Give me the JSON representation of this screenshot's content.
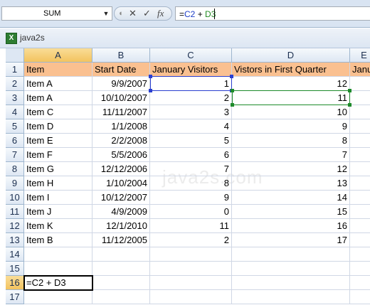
{
  "name_box": {
    "value": "SUM"
  },
  "formula_buttons": {
    "cancel": "✕",
    "enter": "✓",
    "fx": "fx"
  },
  "formula": {
    "prefix": "=",
    "ref1": "C2",
    "op": " + ",
    "ref2": "D3"
  },
  "workbook": {
    "title": "java2s"
  },
  "watermark": "java2s.com",
  "columns": [
    "A",
    "B",
    "C",
    "D",
    "E"
  ],
  "active_column": "A",
  "row_numbers": [
    "1",
    "2",
    "3",
    "4",
    "5",
    "6",
    "7",
    "8",
    "9",
    "10",
    "11",
    "12",
    "13",
    "14",
    "15",
    "16",
    "17"
  ],
  "active_row": "16",
  "headers": {
    "A": "Item",
    "B": "Start Date",
    "C": "January Visitors",
    "D": "Vistors in First Quarter",
    "E": "Janu"
  },
  "rows": [
    {
      "A": "Item A",
      "B": "9/9/2007",
      "C": "1",
      "D": "12"
    },
    {
      "A": "Item A",
      "B": "10/10/2007",
      "C": "2",
      "D": "11"
    },
    {
      "A": "Item C",
      "B": "11/11/2007",
      "C": "3",
      "D": "10"
    },
    {
      "A": "Item D",
      "B": "1/1/2008",
      "C": "4",
      "D": "9"
    },
    {
      "A": "Item E",
      "B": "2/2/2008",
      "C": "5",
      "D": "8"
    },
    {
      "A": "Item F",
      "B": "5/5/2006",
      "C": "6",
      "D": "7"
    },
    {
      "A": "Item G",
      "B": "12/12/2006",
      "C": "7",
      "D": "12"
    },
    {
      "A": "Item H",
      "B": "1/10/2004",
      "C": "8",
      "D": "13"
    },
    {
      "A": "Item I",
      "B": "10/12/2007",
      "C": "9",
      "D": "14"
    },
    {
      "A": "Item J",
      "B": "4/9/2009",
      "C": "0",
      "D": "15"
    },
    {
      "A": "Item K",
      "B": "12/1/2010",
      "C": "11",
      "D": "16"
    },
    {
      "A": "Item B",
      "B": "11/12/2005",
      "C": "2",
      "D": "17"
    }
  ],
  "editing_cell": {
    "ref": "A16",
    "text": "=C2 + D3"
  },
  "colors": {
    "header_fill": "#fac090",
    "ref_blue": "#2a3fd0",
    "ref_green": "#1d8a2a",
    "active_header": "#f3c35e"
  }
}
